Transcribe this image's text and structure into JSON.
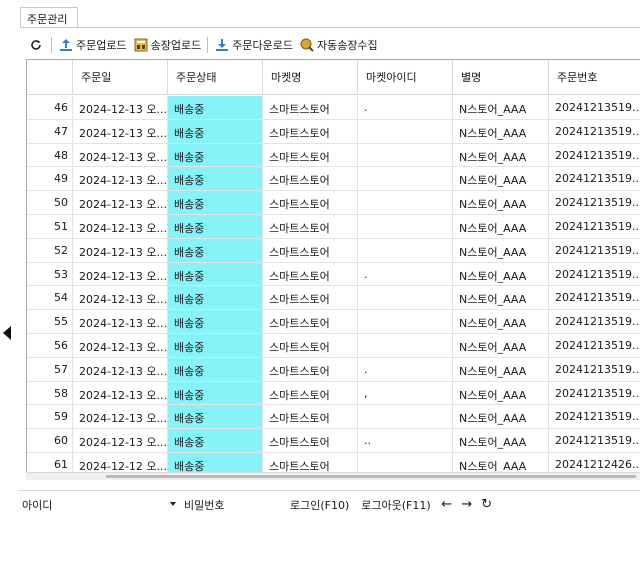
{
  "tab": {
    "label": "주문관리"
  },
  "toolbar": {
    "refresh_icon": "refresh-icon",
    "order_upload": "주문업로드",
    "invoice_upload": "송장업로드",
    "order_download": "주문다운로드",
    "auto_invoice": "자동송장수집"
  },
  "table": {
    "columns": [
      "",
      "주문일",
      "주문상태",
      "마켓명",
      "마켓아이디",
      "별명",
      "주문번호"
    ],
    "status_color": "#87f2f7",
    "rows": [
      {
        "no": "46",
        "date": "2024-12-13 오...",
        "status": "배송중",
        "market": "스마트스토어",
        "market_id": ".",
        "nick": "N스토어_AAA",
        "order_no": "20241213519..."
      },
      {
        "no": "47",
        "date": "2024-12-13 오...",
        "status": "배송중",
        "market": "스마트스토어",
        "market_id": "",
        "nick": "N스토어_AAA",
        "order_no": "20241213519..."
      },
      {
        "no": "48",
        "date": "2024-12-13 오...",
        "status": "배송중",
        "market": "스마트스토어",
        "market_id": "",
        "nick": "N스토어_AAA",
        "order_no": "20241213519..."
      },
      {
        "no": "49",
        "date": "2024-12-13 오...",
        "status": "배송중",
        "market": "스마트스토어",
        "market_id": "",
        "nick": "N스토어_AAA",
        "order_no": "20241213519..."
      },
      {
        "no": "50",
        "date": "2024-12-13 오...",
        "status": "배송중",
        "market": "스마트스토어",
        "market_id": "",
        "nick": "N스토어_AAA",
        "order_no": "20241213519..."
      },
      {
        "no": "51",
        "date": "2024-12-13 오...",
        "status": "배송중",
        "market": "스마트스토어",
        "market_id": "",
        "nick": "N스토어_AAA",
        "order_no": "20241213519..."
      },
      {
        "no": "52",
        "date": "2024-12-13 오...",
        "status": "배송중",
        "market": "스마트스토어",
        "market_id": "",
        "nick": "N스토어_AAA",
        "order_no": "20241213519..."
      },
      {
        "no": "53",
        "date": "2024-12-13 오...",
        "status": "배송중",
        "market": "스마트스토어",
        "market_id": ".",
        "nick": "N스토어_AAA",
        "order_no": "20241213519..."
      },
      {
        "no": "54",
        "date": "2024-12-13 오...",
        "status": "배송중",
        "market": "스마트스토어",
        "market_id": "",
        "nick": "N스토어_AAA",
        "order_no": "20241213519..."
      },
      {
        "no": "55",
        "date": "2024-12-13 오...",
        "status": "배송중",
        "market": "스마트스토어",
        "market_id": "",
        "nick": "N스토어_AAA",
        "order_no": "20241213519..."
      },
      {
        "no": "56",
        "date": "2024-12-13 오...",
        "status": "배송중",
        "market": "스마트스토어",
        "market_id": "",
        "nick": "N스토어_AAA",
        "order_no": "20241213519..."
      },
      {
        "no": "57",
        "date": "2024-12-13 오...",
        "status": "배송중",
        "market": "스마트스토어",
        "market_id": ".",
        "nick": "N스토어_AAA",
        "order_no": "20241213519..."
      },
      {
        "no": "58",
        "date": "2024-12-13 오...",
        "status": "배송중",
        "market": "스마트스토어",
        "market_id": ",",
        "nick": "N스토어_AAA",
        "order_no": "20241213519..."
      },
      {
        "no": "59",
        "date": "2024-12-13 오...",
        "status": "배송중",
        "market": "스마트스토어",
        "market_id": "",
        "nick": "N스토어_AAA",
        "order_no": "20241213519..."
      },
      {
        "no": "60",
        "date": "2024-12-13 오...",
        "status": "배송중",
        "market": "스마트스토어",
        "market_id": "..",
        "nick": "N스토어_AAA",
        "order_no": "20241213519..."
      },
      {
        "no": "61",
        "date": "2024-12-12 오...",
        "status": "배송중",
        "market": "스마트스토어",
        "market_id": "",
        "nick": "N스토어_AAA",
        "order_no": "20241212426..."
      }
    ]
  },
  "bottom": {
    "id_label": "아이디",
    "password_label": "비밀번호",
    "login": "로그인(F10)",
    "logout": "로그아웃(F11)",
    "back_icon": "arrow-left-icon",
    "forward_icon": "arrow-right-icon",
    "reload_icon": "refresh-icon"
  }
}
